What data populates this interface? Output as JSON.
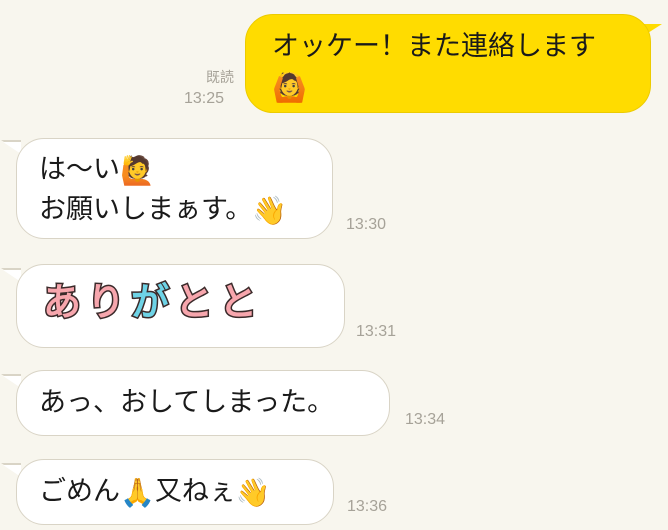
{
  "chat": {
    "messages": [
      {
        "direction": "out",
        "lines": [
          "オッケー！また連絡します"
        ],
        "emoji": "🙆",
        "read_label": "既読",
        "time": "13:25"
      },
      {
        "direction": "in",
        "lines": [
          "は〜い",
          "お願いしまぁす。"
        ],
        "emoji_line1": "🙋",
        "emoji_line2": "👋",
        "time": "13:30"
      },
      {
        "direction": "in",
        "type": "decorated-text",
        "chars": [
          "あ",
          "り",
          "が",
          "と",
          "と"
        ],
        "char_colors": [
          "#f7a6ad",
          "#f7a6ad",
          "#6ed3e6",
          "#f7a6ad",
          "#f7a6ad"
        ],
        "time": "13:31"
      },
      {
        "direction": "in",
        "lines": [
          "あっ、おしてしまった。"
        ],
        "time": "13:34"
      },
      {
        "direction": "in",
        "text_before": "ごめん",
        "emoji_mid": "🙏",
        "text_after": "又ねぇ",
        "emoji_end": "👋",
        "time": "13:36"
      }
    ]
  },
  "colors": {
    "background": "#f8f6ee",
    "out_bubble": "#ffdc00",
    "in_bubble": "#ffffff",
    "meta_text": "#a6a298"
  }
}
